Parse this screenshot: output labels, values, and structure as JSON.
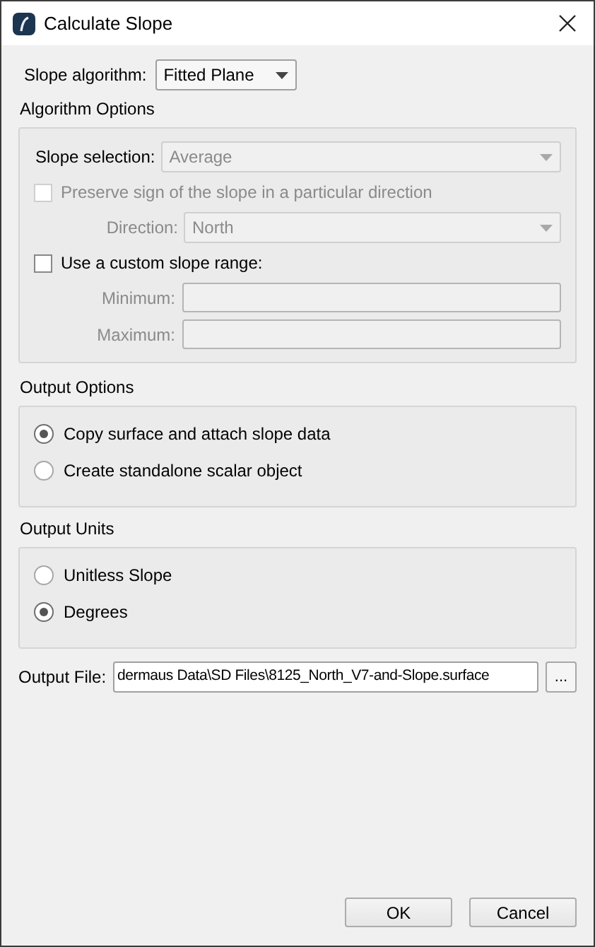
{
  "window": {
    "title": "Calculate Slope"
  },
  "algorithm": {
    "label": "Slope algorithm:",
    "value": "Fitted Plane"
  },
  "algorithm_options": {
    "title": "Algorithm Options",
    "slope_selection": {
      "label": "Slope selection:",
      "value": "Average",
      "disabled": true
    },
    "preserve_sign": {
      "label": "Preserve sign of the slope in a particular direction",
      "checked": false,
      "disabled": true
    },
    "direction": {
      "label": "Direction:",
      "value": "North",
      "disabled": true
    },
    "custom_range": {
      "label": "Use a custom slope range:",
      "checked": false,
      "disabled": false
    },
    "range_fields": [
      {
        "label": "Minimum:",
        "disabled": true
      },
      {
        "label": "Maximum:",
        "disabled": true
      }
    ]
  },
  "output_options": {
    "title": "Output Options",
    "options": [
      {
        "label": "Copy surface and attach slope data",
        "selected": true
      },
      {
        "label": "Create standalone scalar object",
        "selected": false
      }
    ]
  },
  "output_units": {
    "title": "Output Units",
    "options": [
      {
        "label": "Unitless Slope",
        "selected": false
      },
      {
        "label": "Degrees",
        "selected": true
      }
    ]
  },
  "output_file": {
    "label": "Output File:",
    "value": "dermaus Data\\SD Files\\8125_North_V7-and-Slope.surface",
    "browse": "..."
  },
  "buttons": [
    "OK",
    "Cancel"
  ]
}
